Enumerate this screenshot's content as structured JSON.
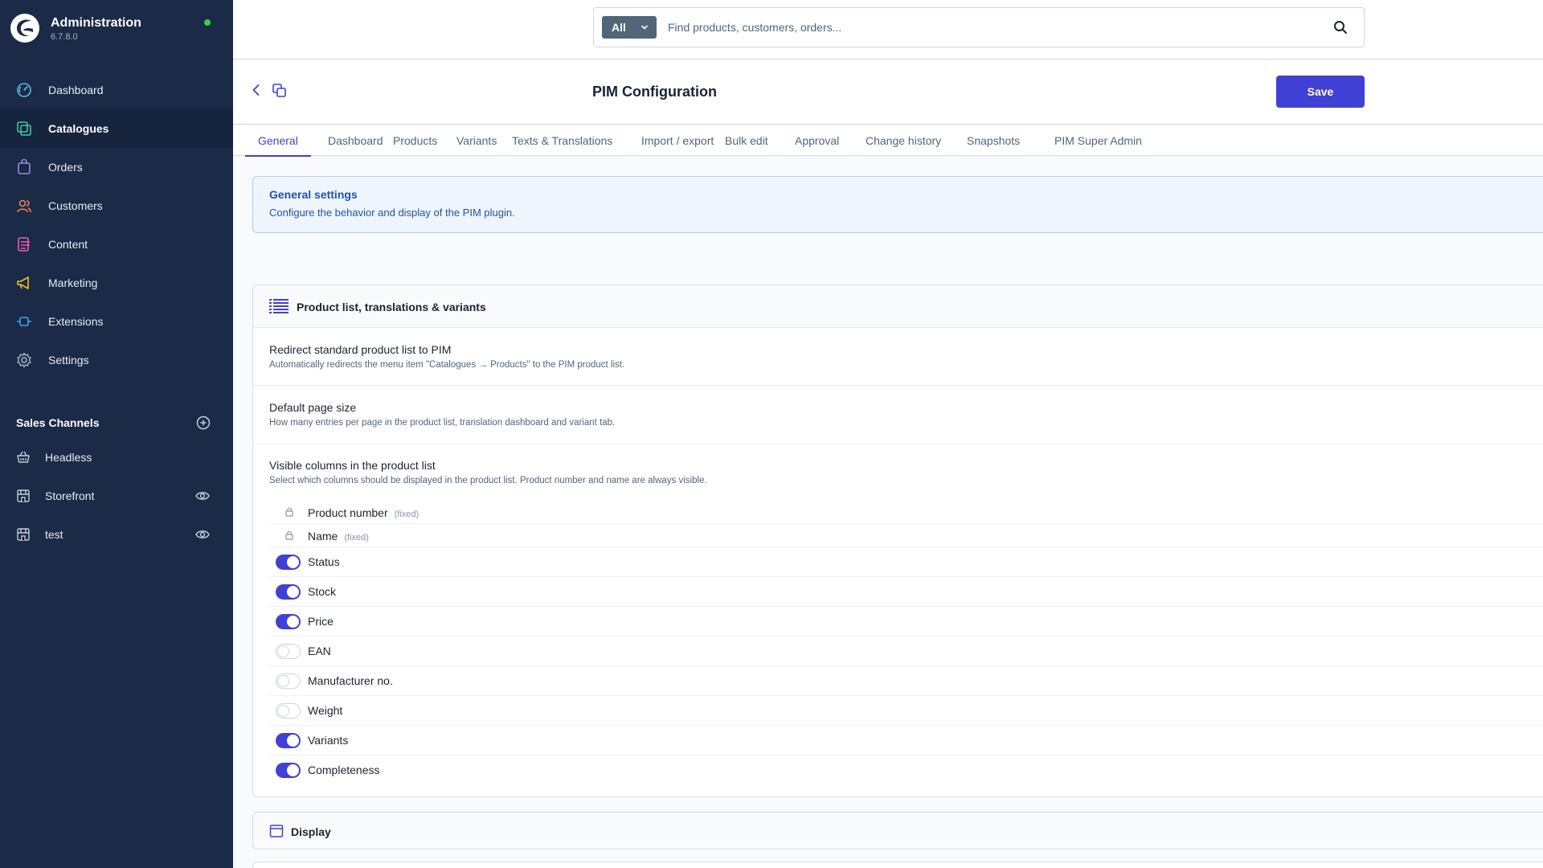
{
  "app": {
    "title": "Administration",
    "version": "6.7.8.0"
  },
  "colors": {
    "sidebar": "#1b2a47",
    "accent": "#4140d4",
    "info_text": "#2252a6",
    "online": "#37d046"
  },
  "nav": [
    {
      "label": "Dashboard",
      "icon": "dashboard-icon",
      "active": false
    },
    {
      "label": "Catalogues",
      "icon": "catalogues-icon",
      "active": true
    },
    {
      "label": "Orders",
      "icon": "orders-icon",
      "active": false
    },
    {
      "label": "Customers",
      "icon": "customers-icon",
      "active": false
    },
    {
      "label": "Content",
      "icon": "content-icon",
      "active": false
    },
    {
      "label": "Marketing",
      "icon": "marketing-icon",
      "active": false
    },
    {
      "label": "Extensions",
      "icon": "extensions-icon",
      "active": false
    },
    {
      "label": "Settings",
      "icon": "settings-icon",
      "active": false
    }
  ],
  "sales_channels": {
    "title": "Sales Channels",
    "items": [
      {
        "label": "Headless",
        "icon": "basket-icon",
        "eye": false
      },
      {
        "label": "Storefront",
        "icon": "storefront-icon",
        "eye": true
      },
      {
        "label": "test",
        "icon": "storefront-icon",
        "eye": true
      }
    ]
  },
  "search": {
    "type": "All",
    "placeholder": "Find products, customers, orders..."
  },
  "page": {
    "title": "PIM Configuration",
    "save_label": "Save"
  },
  "tabs": [
    "General",
    "Dashboard",
    "Products",
    "Variants",
    "Texts & Translations",
    "Import / export",
    "Bulk edit",
    "Approval",
    "Change history",
    "Snapshots",
    "PIM Super Admin"
  ],
  "active_tab": "General",
  "info": {
    "title": "General settings",
    "description": "Configure the behavior and display of the PIM plugin."
  },
  "section": {
    "title": "Product list, translations & variants",
    "settings": [
      {
        "title": "Redirect standard product list to PIM",
        "description": "Automatically redirects the menu item \"Catalogues → Products\" to the PIM product list."
      },
      {
        "title": "Default page size",
        "description": "How many entries per page in the product list, translation dashboard and variant tab."
      },
      {
        "title": "Visible columns in the product list",
        "description": "Select which columns should be displayed in the product list. Product number and name are always visible."
      }
    ],
    "fixed_label": "(fixed)",
    "columns": [
      {
        "label": "Product number",
        "fixed": true,
        "enabled": true
      },
      {
        "label": "Name",
        "fixed": true,
        "enabled": true
      },
      {
        "label": "Status",
        "fixed": false,
        "enabled": true
      },
      {
        "label": "Stock",
        "fixed": false,
        "enabled": true
      },
      {
        "label": "Price",
        "fixed": false,
        "enabled": true
      },
      {
        "label": "EAN",
        "fixed": false,
        "enabled": false
      },
      {
        "label": "Manufacturer no.",
        "fixed": false,
        "enabled": false
      },
      {
        "label": "Weight",
        "fixed": false,
        "enabled": false
      },
      {
        "label": "Variants",
        "fixed": false,
        "enabled": true
      },
      {
        "label": "Completeness",
        "fixed": false,
        "enabled": true
      }
    ]
  },
  "section2": {
    "title": "Display"
  }
}
